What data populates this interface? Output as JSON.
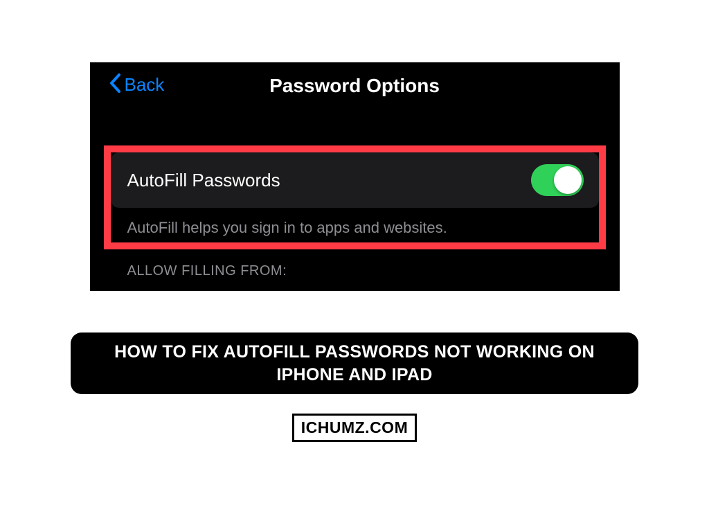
{
  "nav": {
    "back_label": "Back",
    "title": "Password Options"
  },
  "settings": {
    "autofill_label": "AutoFill Passwords",
    "autofill_footer": "AutoFill helps you sign in to apps and websites.",
    "section_header": "ALLOW FILLING FROM:"
  },
  "article": {
    "title": "HOW TO FIX AUTOFILL PASSWORDS NOT WORKING ON IPHONE AND IPAD",
    "site": "ICHUMZ.COM"
  }
}
